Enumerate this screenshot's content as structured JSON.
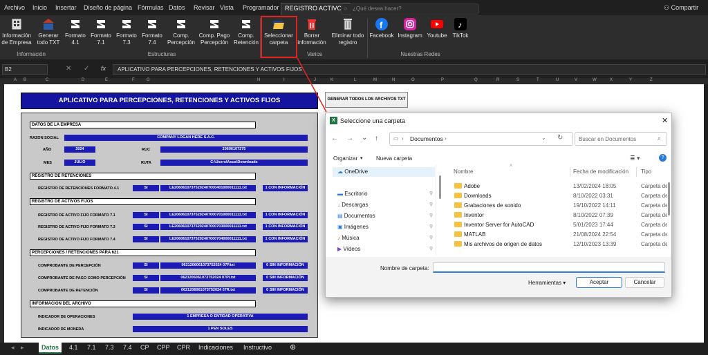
{
  "menu": {
    "tabs": [
      "Archivo",
      "Inicio",
      "Insertar",
      "Diseño de página",
      "Fórmulas",
      "Datos",
      "Revisar",
      "Vista",
      "Programador",
      "REGISTRO ACTIVOS"
    ],
    "search_placeholder": "¿Qué desea hacer?",
    "share": "Compartir"
  },
  "ribbon": {
    "buttons": [
      {
        "icon": "building-icon",
        "label": "Información de Empresa"
      },
      {
        "icon": "txt-generate-icon",
        "label": "Generar todo TXT"
      },
      {
        "icon": "sunat-logo-icon",
        "label": "Formato 4.1"
      },
      {
        "icon": "sunat-logo-icon",
        "label": "Formato 7.1"
      },
      {
        "icon": "sunat-logo-icon",
        "label": "Formato 7.3"
      },
      {
        "icon": "sunat-logo-icon",
        "label": "Formato 7.4"
      },
      {
        "icon": "sunat-logo-icon",
        "label": "Comp. Percepción"
      },
      {
        "icon": "sunat-logo-icon",
        "label": "Comp. Pago Percepción"
      },
      {
        "icon": "sunat-logo-icon",
        "label": "Comp. Retención"
      },
      {
        "icon": "folder-open-icon",
        "label": "Seleccionar carpeta"
      },
      {
        "icon": "trash-icon",
        "label": "Borrar información"
      },
      {
        "icon": "delete-records-icon",
        "label": "Eliminar todo registro"
      },
      {
        "icon": "facebook-icon",
        "label": "Facebook"
      },
      {
        "icon": "instagram-icon",
        "label": "Instagram"
      },
      {
        "icon": "youtube-icon",
        "label": "Youtube"
      },
      {
        "icon": "tiktok-icon",
        "label": "TikTok"
      }
    ],
    "groups": [
      "Información",
      "Estructuras",
      "Varios",
      "Nuestras Redes"
    ]
  },
  "formula_bar": {
    "cell": "B2",
    "fx": "fx",
    "content": "APLICATIVO PARA PERCEPCIONES, RETENCIONES Y ACTIVOS FIJOS"
  },
  "columns": [
    "A",
    "B",
    "C",
    "D",
    "E",
    "F",
    "G",
    "H",
    "I",
    "J",
    "K",
    "L",
    "M",
    "N",
    "O",
    "P",
    "Q",
    "R",
    "S",
    "T",
    "U",
    "V",
    "W",
    "X",
    "Y",
    "Z"
  ],
  "sheet": {
    "title": "APLICATIVO PARA PERCEPCIONES, RETENCIONES Y ACTIVOS FIJOS",
    "gen_button": "GENERAR TODOS LOS ARCHIVOS TXT",
    "empresa_header": "DATOS DE LA EMPRESA",
    "razon_label": "RAZON SOCIAL",
    "razon_value": "COMPANY LOGAN HERE S.A.C.",
    "anio_label": "AÑO",
    "anio_value": "2024",
    "ruc_label": "RUC",
    "ruc_value": "20606107375",
    "mes_label": "MES",
    "mes_value": "JULIO",
    "ruta_label": "RUTA",
    "ruta_value": "C:\\Users\\Asus\\Downloads",
    "ret_header": "REGISTRO DE RETENCIONES",
    "ret_rows": [
      {
        "label": "REGISTRO DE RETENCIONES FORMATO 4.1",
        "si": "SI",
        "file": "LE20606107375202407000401000011111.txt",
        "info": "1 CON INFORMACIÓN"
      }
    ],
    "af_header": "REGISTRO DE ACTIVOS FIJOS",
    "af_rows": [
      {
        "label": "REGISTRO DE ACTIVO FIJO FORMATO 7.1",
        "si": "SI",
        "file": "LE20606107375202407000701000011111.txt",
        "info": "1 CON INFORMACIÓN"
      },
      {
        "label": "REGISTRO DE ACTIVO FIJO FORMATO 7.3",
        "si": "SI",
        "file": "LE20606107375202407000703000011111.txt",
        "info": "1 CON INFORMACIÓN"
      },
      {
        "label": "REGISTRO DE ACTIVO FIJO FORMATO 7.4",
        "si": "SI",
        "file": "LE20606107375202407000704000011111.txt",
        "info": "1 CON INFORMACIÓN"
      }
    ],
    "pr_header": "PERCEPCIONES / RETENCIONES PARA 621",
    "pr_rows": [
      {
        "label": "COMPROBANTE DE PERCEPCIÓN",
        "si": "SI",
        "file": "0621206061073752024 07P.txt",
        "info": "0 SIN INFORMACIÓN"
      },
      {
        "label": "COMPROBANTE DE PAGO COMO PERCEPCIÓN",
        "si": "SI",
        "file": "0621206061073752024 07PI.txt",
        "info": "0 SIN INFORMACIÓN"
      },
      {
        "label": "COMPROBANTE DE RETENCIÓN",
        "si": "SI",
        "file": "0621206061073752024 07R.txt",
        "info": "0 SIN INFORMACIÓN"
      }
    ],
    "arch_header": "INFORMACION DEL ARCHIVO",
    "ind_op_label": "INDICADOR DE OPERACIONES",
    "ind_op_value": "1 EMPRESA O ENTIDAD OPERATIVA",
    "ind_mon_label": "INDICADOR DE MONEDA",
    "ind_mon_value": "1 PEN SOLES"
  },
  "sheet_tabs": [
    "Datos",
    "4.1",
    "7.1",
    "7.3",
    "7.4",
    "CP",
    "CPP",
    "CPR",
    "Indicaciones",
    "Instructivo"
  ],
  "dialog": {
    "title": "Seleccione una carpeta",
    "breadcrumb": "Documentos",
    "search_placeholder": "Buscar en Documentos",
    "organize": "Organizar",
    "new_folder": "Nueva carpeta",
    "nav": [
      "OneDrive",
      "Escritorio",
      "Descargas",
      "Documentos",
      "Imágenes",
      "Música",
      "Vídeos"
    ],
    "col_name": "Nombre",
    "col_date": "Fecha de modificación",
    "col_type": "Tipo",
    "files": [
      {
        "name": "Adobe",
        "date": "13/02/2024 18:05",
        "type": "Carpeta de"
      },
      {
        "name": "Downloads",
        "date": "8/10/2022 03:31",
        "type": "Carpeta de"
      },
      {
        "name": "Grabaciones de sonido",
        "date": "19/10/2022 14:11",
        "type": "Carpeta de"
      },
      {
        "name": "Inventor",
        "date": "8/10/2022 07:39",
        "type": "Carpeta de"
      },
      {
        "name": "Inventor Server for AutoCAD",
        "date": "5/01/2023 17:44",
        "type": "Carpeta de"
      },
      {
        "name": "MATLAB",
        "date": "21/08/2024 22:54",
        "type": "Carpeta de"
      },
      {
        "name": "Mis archivos de origen de datos",
        "date": "12/10/2023 13:39",
        "type": "Carpeta de"
      }
    ],
    "folder_label": "Nombre de carpeta:",
    "tools": "Herramientas",
    "accept": "Aceptar",
    "cancel": "Cancelar"
  }
}
